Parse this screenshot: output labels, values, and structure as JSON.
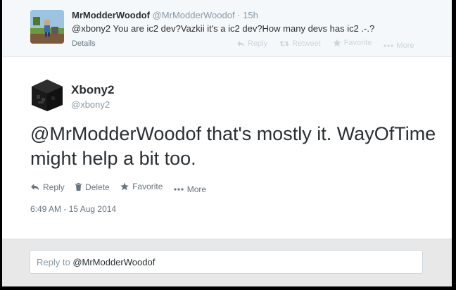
{
  "parent_tweet": {
    "name": "MrModderWoodof",
    "handle": "@MrModderWoodof",
    "time": "· 15h",
    "text": "@xbony2 You are ic2 dev?Vazkii it's a ic2 dev?How many devs has ic2 .-.?",
    "details_label": "Details",
    "actions": {
      "reply": "Reply",
      "retweet": "Retweet",
      "favorite": "Favorite",
      "more": "More"
    }
  },
  "main_tweet": {
    "name": "Xbony2",
    "handle": "@xbony2",
    "text": "@MrModderWoodof that's mostly it. WayOfTime might help a bit too.",
    "actions": {
      "reply": "Reply",
      "delete": "Delete",
      "favorite": "Favorite",
      "more": "More"
    },
    "timestamp": "6:49 AM - 15 Aug 2014"
  },
  "reply_box": {
    "prefix": "Reply to",
    "user": "@MrModderWoodof"
  },
  "colors": {
    "text": "#292f33",
    "muted": "#8899a6",
    "action": "#66757f",
    "faded_action": "#ccd6dd",
    "parent_bg": "#f5f8fa",
    "reply_bg": "#e8e8e8"
  }
}
